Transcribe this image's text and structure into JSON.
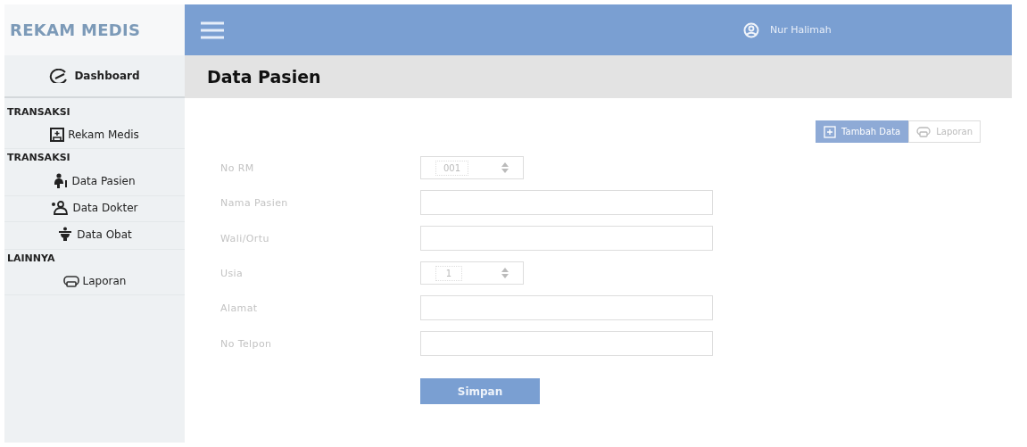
{
  "brand": "REKAM MEDIS",
  "user": {
    "name": "Nur Halimah"
  },
  "sidebar": {
    "dashboard": "Dashboard",
    "sections": [
      {
        "heading": "TRANSAKSI",
        "items": [
          "Rekam Medis"
        ]
      },
      {
        "heading": "TRANSAKSI",
        "items": [
          "Data Pasien",
          "Data Dokter",
          "Data Obat"
        ]
      },
      {
        "heading": "LAINNYA",
        "items": [
          "Laporan"
        ]
      }
    ]
  },
  "page_title": "Data Pasien",
  "toolbar": [
    {
      "label": "Tambah Data",
      "kind": "primary"
    },
    {
      "label": "Laporan",
      "kind": "outline"
    }
  ],
  "form": [
    {
      "label": "No RM",
      "kind": "spinner",
      "value": "001"
    },
    {
      "label": "Nama Pasien",
      "kind": "text"
    },
    {
      "label": "Wali/Ortu",
      "kind": "text"
    },
    {
      "label": "Usia",
      "kind": "spinner",
      "value": "1"
    },
    {
      "label": "Alamat",
      "kind": "text"
    },
    {
      "label": "No Telpon",
      "kind": "text"
    }
  ],
  "submit": "Simpan"
}
